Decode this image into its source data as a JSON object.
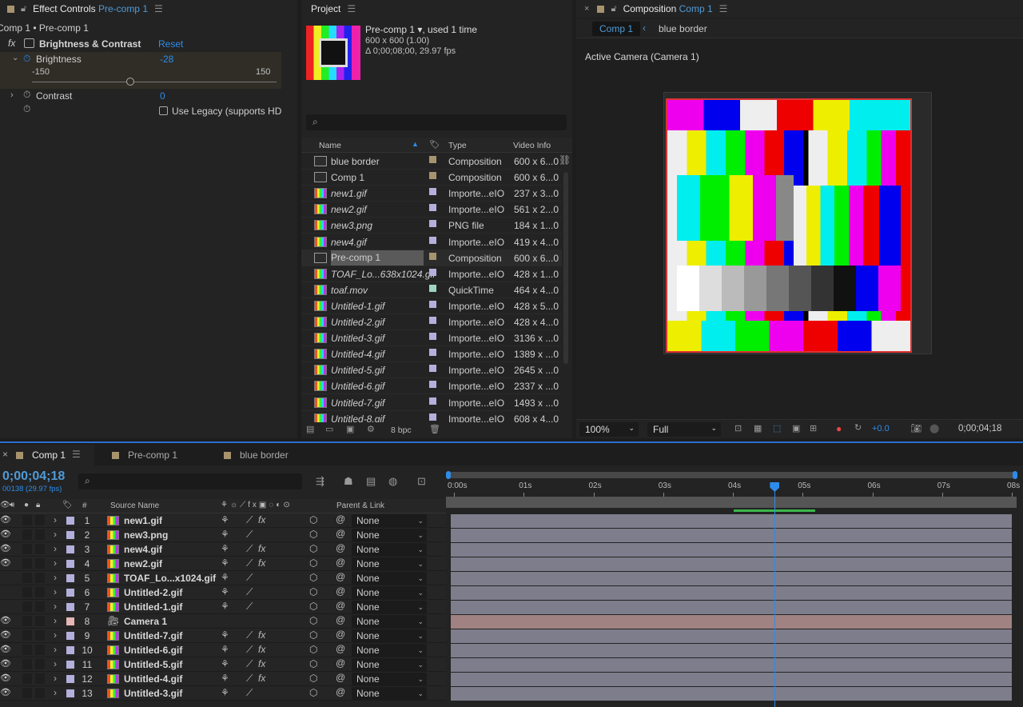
{
  "effect_panel": {
    "title": "Effect Controls",
    "target": "Pre-comp 1",
    "breadcrumb": "Comp 1 • Pre-comp 1",
    "effect_name": "Brightness & Contrast",
    "reset": "Reset",
    "brightness_label": "Brightness",
    "brightness_value": "-28",
    "slider_min": "-150",
    "slider_max": "150",
    "contrast_label": "Contrast",
    "contrast_value": "0",
    "legacy_label": "Use Legacy (supports HD",
    "fx": "fx"
  },
  "project_panel": {
    "title": "Project",
    "item_name": "Pre-comp 1",
    "used": ", used 1 time",
    "dims": "600 x 600 (1.00)",
    "duration": "Δ 0;00;08;00, 29.97 fps",
    "col_name": "Name",
    "col_type": "Type",
    "col_video": "Video Info",
    "bpc": "8 bpc",
    "items": [
      {
        "name": "blue border",
        "type": "Composition",
        "info": "600 x 6...0",
        "comp": true,
        "italic": false,
        "color": "#a8936f"
      },
      {
        "name": "Comp 1",
        "type": "Composition",
        "info": "600 x 6...0",
        "comp": true,
        "italic": false,
        "color": "#a8936f"
      },
      {
        "name": "new1.gif",
        "type": "Importe...eIO",
        "info": "237 x 3...0",
        "comp": false,
        "italic": true,
        "color": "#b4b0dc"
      },
      {
        "name": "new2.gif",
        "type": "Importe...eIO",
        "info": "561 x 2...0",
        "comp": false,
        "italic": true,
        "color": "#b4b0dc"
      },
      {
        "name": "new3.png",
        "type": "PNG file",
        "info": "184 x 1...0",
        "comp": false,
        "italic": true,
        "color": "#b4b0dc"
      },
      {
        "name": "new4.gif",
        "type": "Importe...eIO",
        "info": "419 x 4...0",
        "comp": false,
        "italic": true,
        "color": "#b4b0dc"
      },
      {
        "name": "Pre-comp 1",
        "type": "Composition",
        "info": "600 x 6...0",
        "comp": true,
        "italic": false,
        "color": "#a8936f",
        "selected": true
      },
      {
        "name": "TOAF_Lo...638x1024.gif",
        "type": "Importe...eIO",
        "info": "428 x 1...0",
        "comp": false,
        "italic": true,
        "color": "#b4b0dc"
      },
      {
        "name": "toaf.mov",
        "type": "QuickTime",
        "info": "464 x 4...0",
        "comp": false,
        "italic": true,
        "color": "#9fd4bf"
      },
      {
        "name": "Untitled-1.gif",
        "type": "Importe...eIO",
        "info": "428 x 5...0",
        "comp": false,
        "italic": true,
        "color": "#b4b0dc"
      },
      {
        "name": "Untitled-2.gif",
        "type": "Importe...eIO",
        "info": "428 x 4...0",
        "comp": false,
        "italic": true,
        "color": "#b4b0dc"
      },
      {
        "name": "Untitled-3.gif",
        "type": "Importe...eIO",
        "info": "3136 x ...0",
        "comp": false,
        "italic": true,
        "color": "#b4b0dc"
      },
      {
        "name": "Untitled-4.gif",
        "type": "Importe...eIO",
        "info": "1389 x ...0",
        "comp": false,
        "italic": true,
        "color": "#b4b0dc"
      },
      {
        "name": "Untitled-5.gif",
        "type": "Importe...eIO",
        "info": "2645 x ...0",
        "comp": false,
        "italic": true,
        "color": "#b4b0dc"
      },
      {
        "name": "Untitled-6.gif",
        "type": "Importe...eIO",
        "info": "2337 x ...0",
        "comp": false,
        "italic": true,
        "color": "#b4b0dc"
      },
      {
        "name": "Untitled-7.gif",
        "type": "Importe...eIO",
        "info": "1493 x ...0",
        "comp": false,
        "italic": true,
        "color": "#b4b0dc"
      },
      {
        "name": "Untitled-8.gif",
        "type": "Importe...eIO",
        "info": "608 x 4...0",
        "comp": false,
        "italic": true,
        "color": "#b4b0dc"
      }
    ]
  },
  "comp_panel": {
    "title": "Composition",
    "comp_name": "Comp 1",
    "crumb_active": "Comp 1",
    "crumb_next": "blue border",
    "camera": "Active Camera (Camera 1)",
    "zoom": "100%",
    "resolution": "Full",
    "exposure": "+0.0",
    "timecode": "0;00;04;18"
  },
  "timeline": {
    "tabs": [
      "Comp 1",
      "Pre-comp 1",
      "blue border"
    ],
    "timecode": "0;00;04;18",
    "frames": "00138 (29.97 fps)",
    "col_num": "#",
    "col_source": "Source Name",
    "col_parent": "Parent & Link",
    "ruler": [
      "0:00s",
      "01s",
      "02s",
      "03s",
      "04s",
      "05s",
      "06s",
      "07s",
      "08s"
    ],
    "playhead_frame": 138,
    "total_frames": 240,
    "layers": [
      {
        "num": "1",
        "name": "new1.gif",
        "fx": true,
        "color": "#b4b0dc",
        "parent": "None",
        "eye": true
      },
      {
        "num": "2",
        "name": "new3.png",
        "fx": false,
        "color": "#b4b0dc",
        "parent": "None",
        "eye": true
      },
      {
        "num": "3",
        "name": "new4.gif",
        "fx": true,
        "color": "#b4b0dc",
        "parent": "None",
        "eye": true
      },
      {
        "num": "4",
        "name": "new2.gif",
        "fx": true,
        "color": "#b4b0dc",
        "parent": "None",
        "eye": true
      },
      {
        "num": "5",
        "name": "TOAF_Lo...x1024.gif",
        "fx": false,
        "color": "#b4b0dc",
        "parent": "None",
        "eye": false
      },
      {
        "num": "6",
        "name": "Untitled-2.gif",
        "fx": false,
        "color": "#b4b0dc",
        "parent": "None",
        "eye": false
      },
      {
        "num": "7",
        "name": "Untitled-1.gif",
        "fx": false,
        "color": "#b4b0dc",
        "parent": "None",
        "eye": false
      },
      {
        "num": "8",
        "name": "Camera 1",
        "fx": false,
        "color": "#e6b5b5",
        "parent": "None",
        "eye": true,
        "camera": true
      },
      {
        "num": "9",
        "name": "Untitled-7.gif",
        "fx": true,
        "color": "#b4b0dc",
        "parent": "None",
        "eye": true
      },
      {
        "num": "10",
        "name": "Untitled-6.gif",
        "fx": true,
        "color": "#b4b0dc",
        "parent": "None",
        "eye": true
      },
      {
        "num": "11",
        "name": "Untitled-5.gif",
        "fx": true,
        "color": "#b4b0dc",
        "parent": "None",
        "eye": true
      },
      {
        "num": "12",
        "name": "Untitled-4.gif",
        "fx": true,
        "color": "#b4b0dc",
        "parent": "None",
        "eye": true
      },
      {
        "num": "13",
        "name": "Untitled-3.gif",
        "fx": false,
        "color": "#b4b0dc",
        "parent": "None",
        "eye": true
      }
    ]
  }
}
